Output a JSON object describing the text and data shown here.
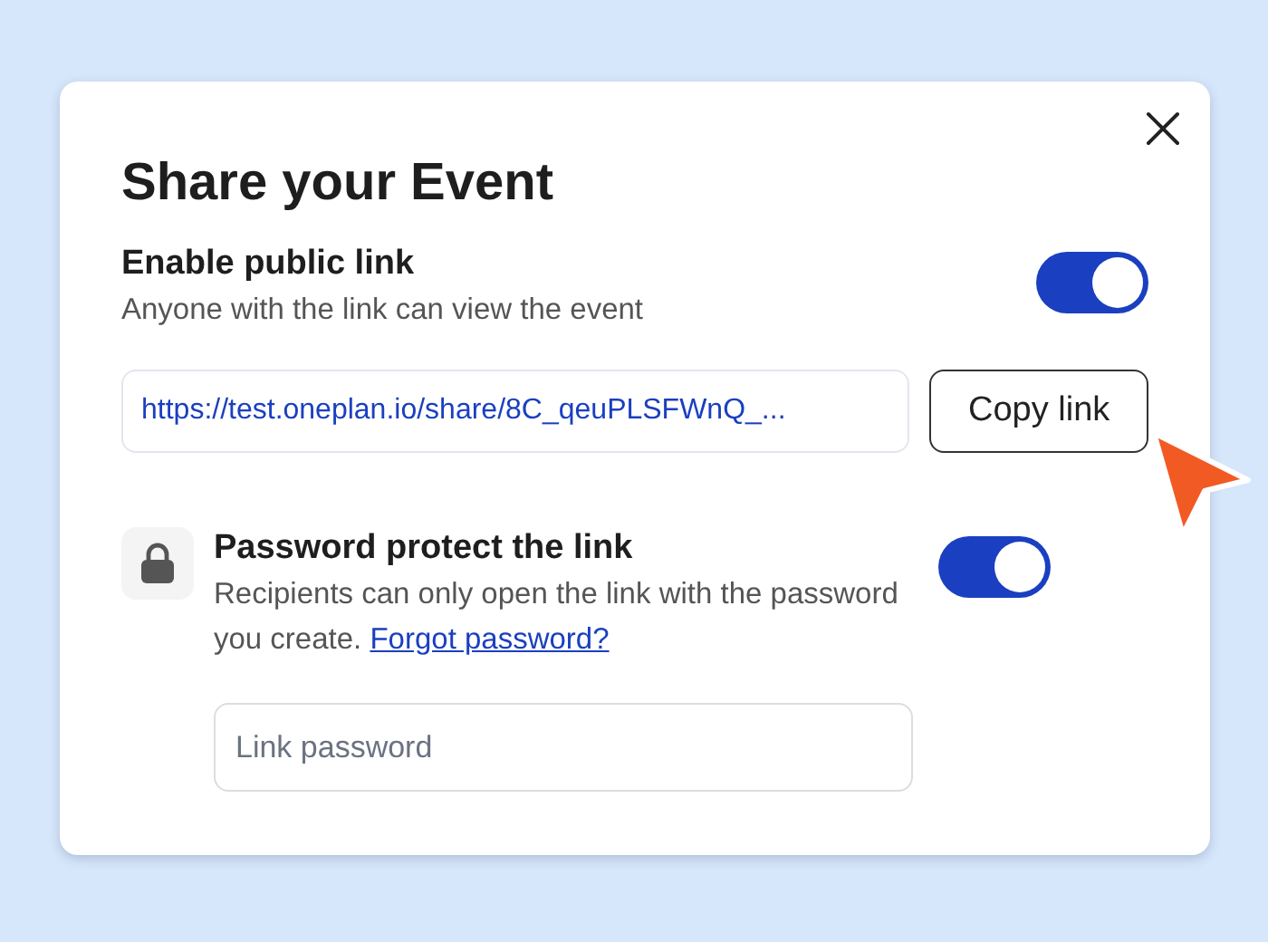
{
  "dialog": {
    "title": "Share your Event"
  },
  "public_link": {
    "label": "Enable public link",
    "description": "Anyone with the link can view the event",
    "on": true,
    "url": "https://test.oneplan.io/share/8C_qeuPLSFWnQ_...",
    "copy_button": "Copy link"
  },
  "password": {
    "label": "Password protect the link",
    "description": "Recipients can only open the link with the password you create.",
    "link": "Forgot password?",
    "on": true,
    "placeholder": "Link password"
  }
}
